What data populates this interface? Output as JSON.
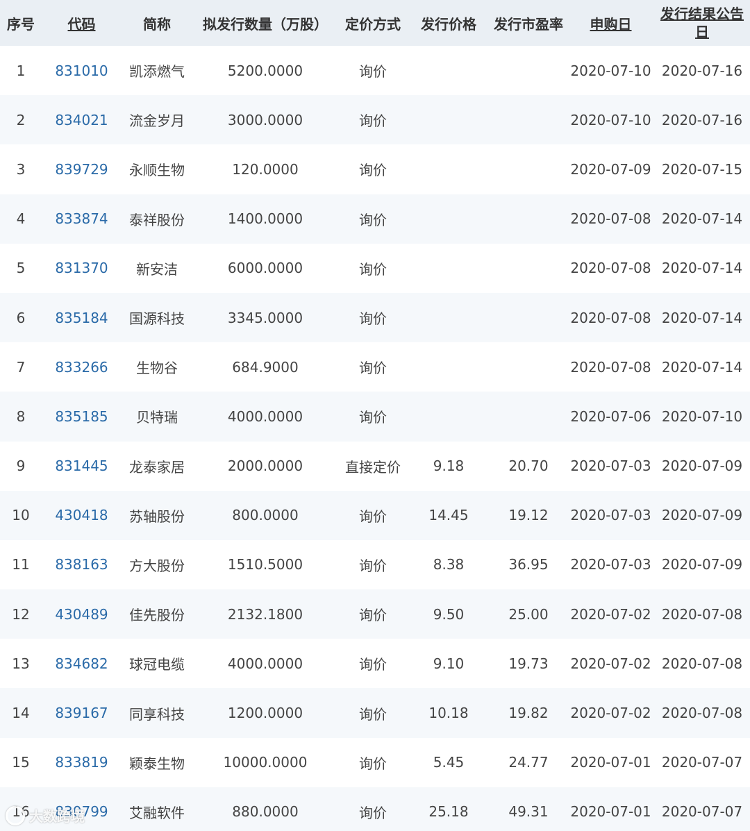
{
  "headers": {
    "seq": "序号",
    "code": "代码",
    "name": "简称",
    "shares": "拟发行数量（万股）",
    "method": "定价方式",
    "price": "发行价格",
    "pe": "发行市盈率",
    "subscribe_date": "申购日",
    "result_date": "发行结果公告日"
  },
  "rows": [
    {
      "seq": "1",
      "code": "831010",
      "name": "凯添燃气",
      "shares": "5200.0000",
      "method": "询价",
      "price": "",
      "pe": "",
      "subscribe_date": "2020-07-10",
      "result_date": "2020-07-16"
    },
    {
      "seq": "2",
      "code": "834021",
      "name": "流金岁月",
      "shares": "3000.0000",
      "method": "询价",
      "price": "",
      "pe": "",
      "subscribe_date": "2020-07-10",
      "result_date": "2020-07-16"
    },
    {
      "seq": "3",
      "code": "839729",
      "name": "永顺生物",
      "shares": "120.0000",
      "method": "询价",
      "price": "",
      "pe": "",
      "subscribe_date": "2020-07-09",
      "result_date": "2020-07-15"
    },
    {
      "seq": "4",
      "code": "833874",
      "name": "泰祥股份",
      "shares": "1400.0000",
      "method": "询价",
      "price": "",
      "pe": "",
      "subscribe_date": "2020-07-08",
      "result_date": "2020-07-14"
    },
    {
      "seq": "5",
      "code": "831370",
      "name": "新安洁",
      "shares": "6000.0000",
      "method": "询价",
      "price": "",
      "pe": "",
      "subscribe_date": "2020-07-08",
      "result_date": "2020-07-14"
    },
    {
      "seq": "6",
      "code": "835184",
      "name": "国源科技",
      "shares": "3345.0000",
      "method": "询价",
      "price": "",
      "pe": "",
      "subscribe_date": "2020-07-08",
      "result_date": "2020-07-14"
    },
    {
      "seq": "7",
      "code": "833266",
      "name": "生物谷",
      "shares": "684.9000",
      "method": "询价",
      "price": "",
      "pe": "",
      "subscribe_date": "2020-07-08",
      "result_date": "2020-07-14"
    },
    {
      "seq": "8",
      "code": "835185",
      "name": "贝特瑞",
      "shares": "4000.0000",
      "method": "询价",
      "price": "",
      "pe": "",
      "subscribe_date": "2020-07-06",
      "result_date": "2020-07-10"
    },
    {
      "seq": "9",
      "code": "831445",
      "name": "龙泰家居",
      "shares": "2000.0000",
      "method": "直接定价",
      "price": "9.18",
      "pe": "20.70",
      "subscribe_date": "2020-07-03",
      "result_date": "2020-07-09"
    },
    {
      "seq": "10",
      "code": "430418",
      "name": "苏轴股份",
      "shares": "800.0000",
      "method": "询价",
      "price": "14.45",
      "pe": "19.12",
      "subscribe_date": "2020-07-03",
      "result_date": "2020-07-09"
    },
    {
      "seq": "11",
      "code": "838163",
      "name": "方大股份",
      "shares": "1510.5000",
      "method": "询价",
      "price": "8.38",
      "pe": "36.95",
      "subscribe_date": "2020-07-03",
      "result_date": "2020-07-09"
    },
    {
      "seq": "12",
      "code": "430489",
      "name": "佳先股份",
      "shares": "2132.1800",
      "method": "询价",
      "price": "9.50",
      "pe": "25.00",
      "subscribe_date": "2020-07-02",
      "result_date": "2020-07-08"
    },
    {
      "seq": "13",
      "code": "834682",
      "name": "球冠电缆",
      "shares": "4000.0000",
      "method": "询价",
      "price": "9.10",
      "pe": "19.73",
      "subscribe_date": "2020-07-02",
      "result_date": "2020-07-08"
    },
    {
      "seq": "14",
      "code": "839167",
      "name": "同享科技",
      "shares": "1200.0000",
      "method": "询价",
      "price": "10.18",
      "pe": "19.82",
      "subscribe_date": "2020-07-02",
      "result_date": "2020-07-08"
    },
    {
      "seq": "15",
      "code": "833819",
      "name": "颖泰生物",
      "shares": "10000.0000",
      "method": "询价",
      "price": "5.45",
      "pe": "24.77",
      "subscribe_date": "2020-07-01",
      "result_date": "2020-07-07"
    },
    {
      "seq": "16",
      "code": "830799",
      "name": "艾融软件",
      "shares": "880.0000",
      "method": "询价",
      "price": "25.18",
      "pe": "49.31",
      "subscribe_date": "2020-07-01",
      "result_date": "2020-07-07"
    }
  ],
  "watermark": {
    "text": "大数跨境",
    "icon": "brand-logo-icon"
  },
  "colors": {
    "header_bg": "#eaeff4",
    "row_even_bg": "#f5f8fb",
    "code_link": "#2a6aa8"
  }
}
